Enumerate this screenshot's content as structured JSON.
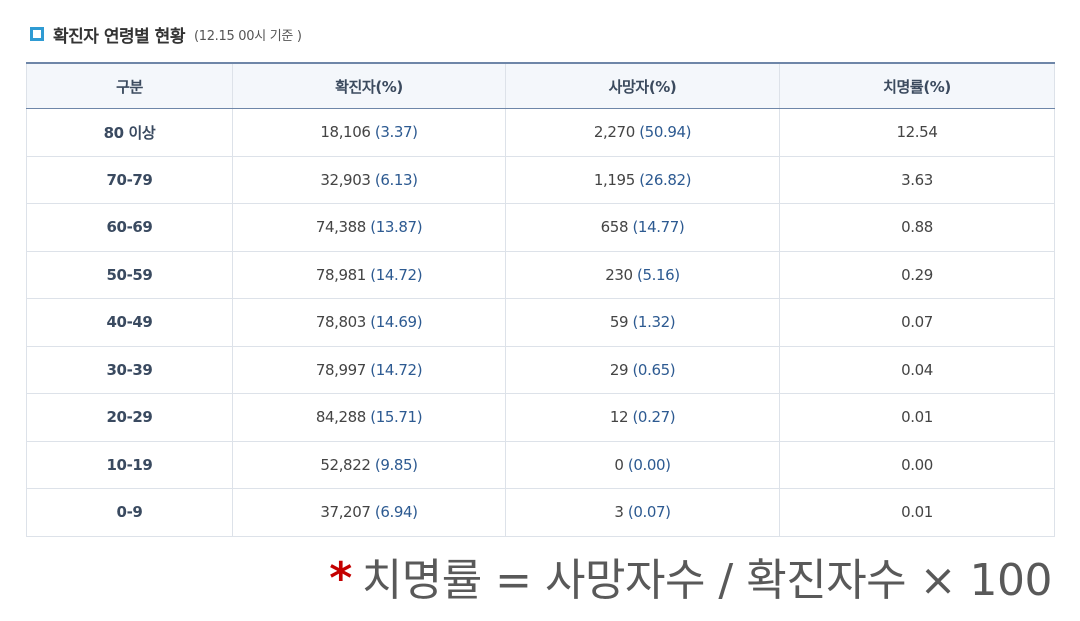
{
  "header": {
    "title": "확진자 연령별 현황",
    "subtitle": "(12.15 00시 기준 )"
  },
  "table": {
    "columns": [
      "구분",
      "확진자(%)",
      "사망자(%)",
      "치명률(%)"
    ],
    "rows": [
      {
        "age": "80 이상",
        "confirmed": "18,106",
        "confirmed_pct": "(3.37)",
        "deaths": "2,270",
        "deaths_pct": "(50.94)",
        "fatality": "12.54"
      },
      {
        "age": "70-79",
        "confirmed": "32,903",
        "confirmed_pct": "(6.13)",
        "deaths": "1,195",
        "deaths_pct": "(26.82)",
        "fatality": "3.63"
      },
      {
        "age": "60-69",
        "confirmed": "74,388",
        "confirmed_pct": "(13.87)",
        "deaths": "658",
        "deaths_pct": "(14.77)",
        "fatality": "0.88"
      },
      {
        "age": "50-59",
        "confirmed": "78,981",
        "confirmed_pct": "(14.72)",
        "deaths": "230",
        "deaths_pct": "(5.16)",
        "fatality": "0.29"
      },
      {
        "age": "40-49",
        "confirmed": "78,803",
        "confirmed_pct": "(14.69)",
        "deaths": "59",
        "deaths_pct": "(1.32)",
        "fatality": "0.07"
      },
      {
        "age": "30-39",
        "confirmed": "78,997",
        "confirmed_pct": "(14.72)",
        "deaths": "29",
        "deaths_pct": "(0.65)",
        "fatality": "0.04"
      },
      {
        "age": "20-29",
        "confirmed": "84,288",
        "confirmed_pct": "(15.71)",
        "deaths": "12",
        "deaths_pct": "(0.27)",
        "fatality": "0.01"
      },
      {
        "age": "10-19",
        "confirmed": "52,822",
        "confirmed_pct": "(9.85)",
        "deaths": "0",
        "deaths_pct": "(0.00)",
        "fatality": "0.00"
      },
      {
        "age": "0-9",
        "confirmed": "37,207",
        "confirmed_pct": "(6.94)",
        "deaths": "3",
        "deaths_pct": "(0.07)",
        "fatality": "0.01"
      }
    ]
  },
  "footnote": {
    "star": "*",
    "text": "치명률 = 사망자수 / 확진자수 × 100"
  }
}
